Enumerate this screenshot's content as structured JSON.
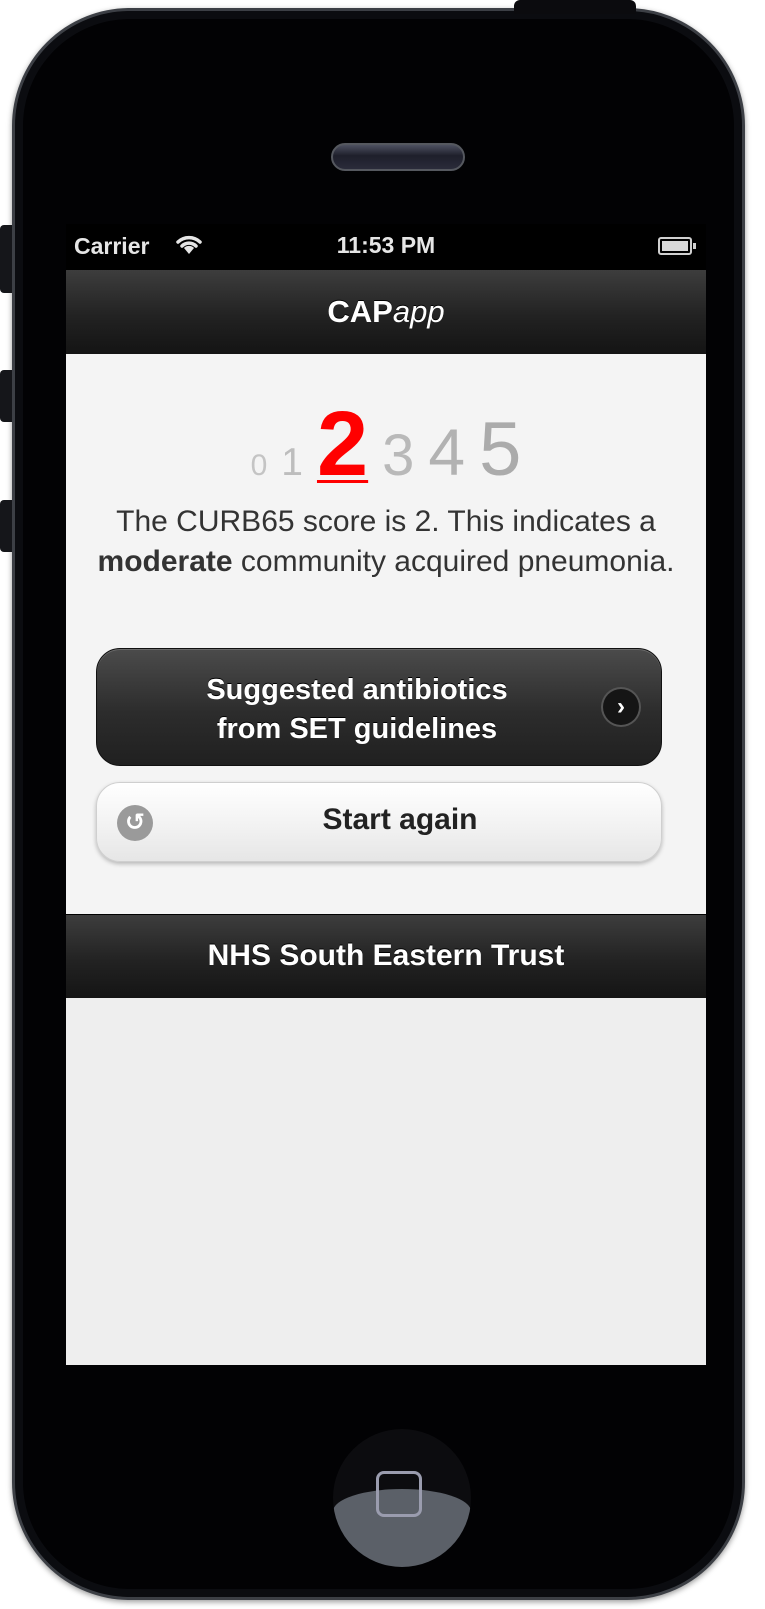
{
  "status_bar": {
    "carrier": "Carrier",
    "time": "11:53 PM"
  },
  "nav": {
    "title_bold": "CAP",
    "title_italic": "app"
  },
  "score": {
    "value": "2",
    "scale": [
      "0",
      "1",
      "2",
      "3",
      "4",
      "5"
    ],
    "description_prefix": "The CURB65 score is 2. This indicates a",
    "severity": "moderate",
    "description_suffix": "community acquired pneumonia."
  },
  "buttons": {
    "antibiotics_line1": "Suggested antibiotics",
    "antibiotics_line2": "from SET guidelines",
    "start_again": "Start again"
  },
  "footer": {
    "label": "NHS South Eastern Trust"
  },
  "colors": {
    "selected_score": "#ff0000",
    "bar_dark": "#222222",
    "content_bg": "#f4f4f4"
  },
  "icons": {
    "chevron": "chevron-right-icon",
    "undo": "undo-icon",
    "wifi": "wifi-icon",
    "battery": "battery-icon"
  }
}
